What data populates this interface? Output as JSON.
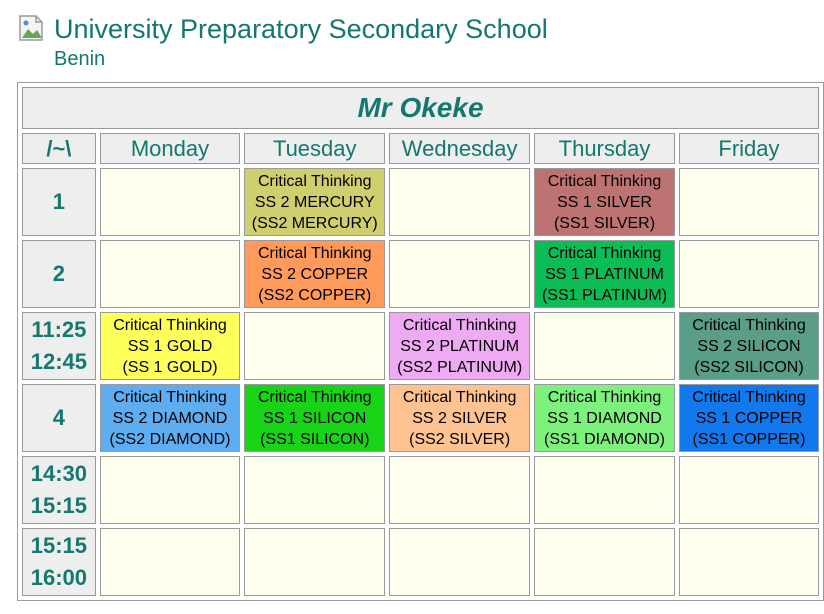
{
  "school": {
    "name": "University Preparatory Secondary School",
    "location": "Benin",
    "logo_icon": "broken-image-icon"
  },
  "timetable": {
    "teacher": "Mr Okeke",
    "corner": "/~\\",
    "days": [
      "Monday",
      "Tuesday",
      "Wednesday",
      "Thursday",
      "Friday"
    ],
    "rows": [
      {
        "period": [
          "1"
        ],
        "cells": [
          null,
          {
            "subject": "Critical Thinking",
            "class": "SS 2 MERCURY",
            "room": "(SS2 MERCURY)",
            "color": "#cfcf6f"
          },
          null,
          {
            "subject": "Critical Thinking",
            "class": "SS 1 SILVER",
            "room": "(SS1 SILVER)",
            "color": "#bd7371"
          },
          null
        ]
      },
      {
        "period": [
          "2"
        ],
        "cells": [
          null,
          {
            "subject": "Critical Thinking",
            "class": "SS 2 COPPER",
            "room": "(SS2 COPPER)",
            "color": "#ff9a5a"
          },
          null,
          {
            "subject": "Critical Thinking",
            "class": "SS 1 PLATINUM",
            "room": "(SS1 PLATINUM)",
            "color": "#0cbd56"
          },
          null
        ]
      },
      {
        "period": [
          "11:25",
          "12:45"
        ],
        "cells": [
          {
            "subject": "Critical Thinking",
            "class": "SS 1 GOLD",
            "room": "(SS 1 GOLD)",
            "color": "#ffff5c"
          },
          null,
          {
            "subject": "Critical Thinking",
            "class": "SS 2 PLATINUM",
            "room": "(SS2 PLATINUM)",
            "color": "#eeaaf3"
          },
          null,
          {
            "subject": "Critical Thinking",
            "class": "SS 2 SILICON",
            "room": "(SS2 SILICON)",
            "color": "#5a9e88"
          }
        ]
      },
      {
        "period": [
          "4"
        ],
        "cells": [
          {
            "subject": "Critical Thinking",
            "class": "SS 2 DIAMOND",
            "room": "(SS2 DIAMOND)",
            "color": "#5eadf0"
          },
          {
            "subject": "Critical Thinking",
            "class": "SS 1 SILICON",
            "room": "(SS1 SILICON)",
            "color": "#17d417"
          },
          {
            "subject": "Critical Thinking",
            "class": "SS 2 SILVER",
            "room": "(SS2 SILVER)",
            "color": "#ffc392"
          },
          {
            "subject": "Critical Thinking",
            "class": "SS 1 DIAMOND",
            "room": "(SS1 DIAMOND)",
            "color": "#7cf27c"
          },
          {
            "subject": "Critical Thinking",
            "class": "SS 1 COPPER",
            "room": "(SS1 COPPER)",
            "color": "#1278ee"
          }
        ]
      },
      {
        "period": [
          "14:30",
          "15:15"
        ],
        "cells": [
          null,
          null,
          null,
          null,
          null
        ]
      },
      {
        "period": [
          "15:15",
          "16:00"
        ],
        "cells": [
          null,
          null,
          null,
          null,
          null
        ]
      }
    ]
  },
  "colors": {
    "accent": "#13786f",
    "empty_cell": "#ffffee",
    "header_bg": "#eeeeee"
  }
}
